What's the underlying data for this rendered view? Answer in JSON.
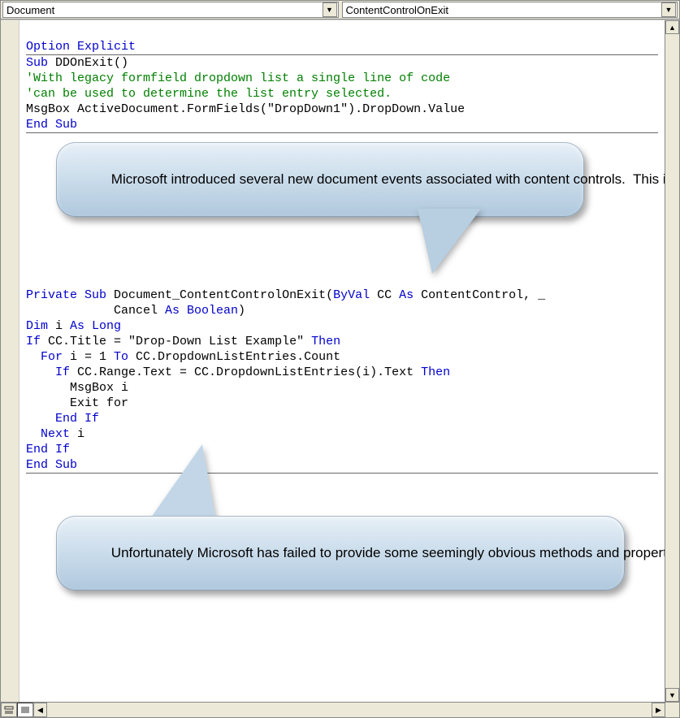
{
  "dropdowns": {
    "object": "Document",
    "procedure": "ContentControlOnExit"
  },
  "code": {
    "block1": {
      "l1_kw1": "Option",
      "l1_kw2": "Explicit",
      "l2_kw": "Sub",
      "l2_name": " DDOnExit()",
      "l3_cm": "'With legacy formfield dropdown list a single line of code",
      "l4_cm": "'can be used to determine the list entry selected.",
      "l5_tx": "MsgBox ActiveDocument.FormFields(\"DropDown1\").DropDown.Value",
      "l6_kw": "End Sub"
    },
    "block2": {
      "p1_kw1": "Private Sub",
      "p1_tx1": " Document_ContentControlOnExit(",
      "p1_kw2": "ByVal",
      "p1_tx2": " CC ",
      "p1_kw3": "As",
      "p1_tx3": " ContentControl, _",
      "p2_tx1": "            Cancel ",
      "p2_kw1": "As Boolean",
      "p2_tx2": ")",
      "p3_kw1": "Dim",
      "p3_tx1": " i ",
      "p3_kw2": "As Long",
      "p4_kw1": "If",
      "p4_tx1": " CC.Title = \"Drop-Down List Example\" ",
      "p4_kw2": "Then",
      "p5_kw1": "  For",
      "p5_tx1": " i = 1 ",
      "p5_kw2": "To",
      "p5_tx2": " CC.DropdownListEntries.Count",
      "p6_kw1": "    If",
      "p6_tx1": " CC.Range.Text = CC.DropdownListEntries(i).Text ",
      "p6_kw2": "Then",
      "p7_tx": "      MsgBox i",
      "p8_tx": "      Exit for",
      "p9_kw": "    End If",
      "p10_kw1": "  Next",
      "p10_tx": " i",
      "p11_kw": "End If",
      "p12_kw": "End Sub"
    }
  },
  "callouts": {
    "c1": "Microsoft introduced several new document events associated with content controls.  This illustrates the \"OnExit\" event wich is fired each time the document user exits a content control",
    "c2": "Unfortunately Microsoft has failed to provide some seemingly obvious methods and properties for working with content controls programatically.  For example, no \".DropDown\" property like the one provided for the legacy formfield object in the first code sample shown above (or the \".ListIndex\" property provided for the userform \"listbox\" object [not shown]) means the developer must loop through each content control list entry until the entry matches the selected entry."
  }
}
